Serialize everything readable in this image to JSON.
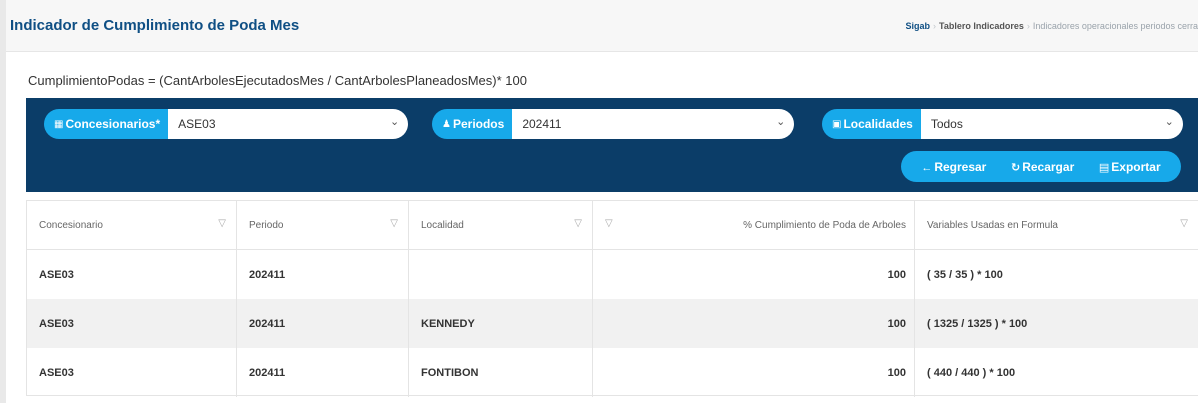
{
  "header": {
    "title": "Indicador de Cumplimiento de Poda Mes",
    "breadcrumb": [
      "Sigab",
      "Tablero Indicadores",
      "Indicadores operacionales periodos cerra"
    ]
  },
  "formula": "CumplimientoPodas = (CantArbolesEjecutadosMes / CantArbolesPlaneadosMes)* 100",
  "filters": {
    "concesionarios": {
      "label": "Concesionarios*",
      "value": "ASE03",
      "icon": "building-icon"
    },
    "periodos": {
      "label": "Periodos",
      "value": "202411",
      "icon": "person-icon"
    },
    "localidades": {
      "label": "Localidades",
      "value": "Todos",
      "icon": "map-icon"
    }
  },
  "actions": {
    "regresar": "Regresar",
    "recargar": "Recargar",
    "exportar": "Exportar"
  },
  "table": {
    "columns": [
      "Concesionario",
      "Periodo",
      "Localidad",
      "% Cumplimiento de Poda de Arboles",
      "Variables Usadas en Formula"
    ],
    "rows": [
      [
        "ASE03",
        "202411",
        "",
        "100",
        "( 35 / 35 ) * 100"
      ],
      [
        "ASE03",
        "202411",
        "KENNEDY",
        "100",
        "( 1325 / 1325 ) * 100"
      ],
      [
        "ASE03",
        "202411",
        "FONTIBON",
        "100",
        "( 440 / 440 ) * 100"
      ]
    ]
  },
  "colors": {
    "title_blue": "#0f4f84",
    "panel_navy": "#0b3d68",
    "accent_cyan": "#17a9ea"
  }
}
